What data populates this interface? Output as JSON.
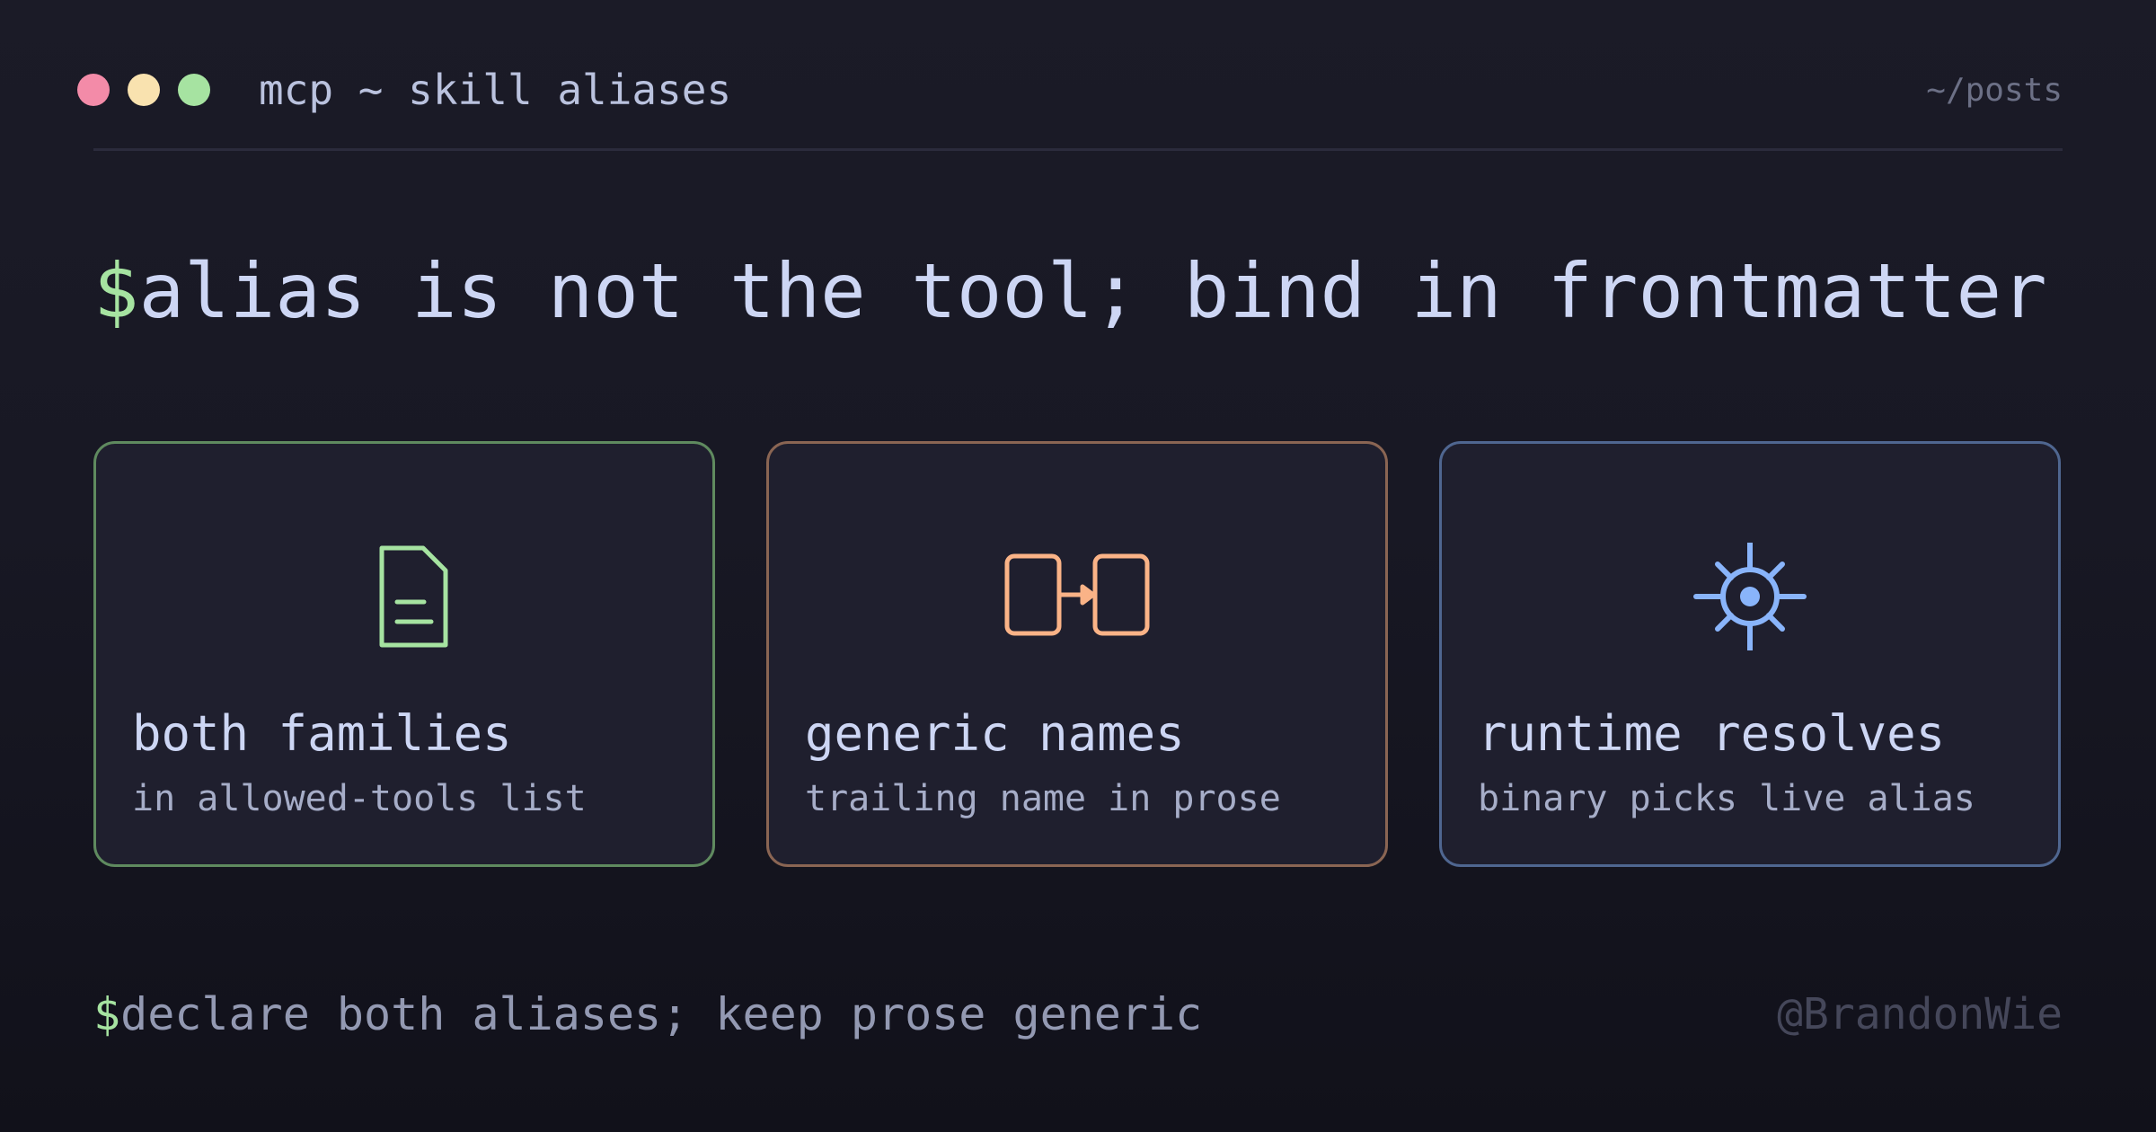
{
  "window": {
    "title": "mcp ~ skill aliases",
    "nav_path": "~/posts",
    "controls": [
      "close-dot",
      "minimize-dot",
      "maximize-dot"
    ]
  },
  "headline": {
    "prompt": "$",
    "text": "alias is not the tool; bind in frontmatter"
  },
  "cards": [
    {
      "icon": "document-icon",
      "title": "both families",
      "subtitle": "in allowed-tools list",
      "accent": "#a6e3a1"
    },
    {
      "icon": "link-boxes-icon",
      "title": "generic names",
      "subtitle": "trailing name in prose",
      "accent": "#fab387"
    },
    {
      "icon": "sun-target-icon",
      "title": "runtime resolves",
      "subtitle": "binary picks live alias",
      "accent": "#89b4fa"
    }
  ],
  "footer": {
    "prompt": "$",
    "text": "declare both aliases; keep prose generic",
    "handle": "@BrandonWie"
  },
  "colors": {
    "background": "#181824",
    "text": "#cdd6f4",
    "prompt": "#a6e3a1",
    "muted": "#6c7086",
    "dot_red": "#f38ba8",
    "dot_yellow": "#f9e2af",
    "dot_green": "#a6e3a1"
  }
}
